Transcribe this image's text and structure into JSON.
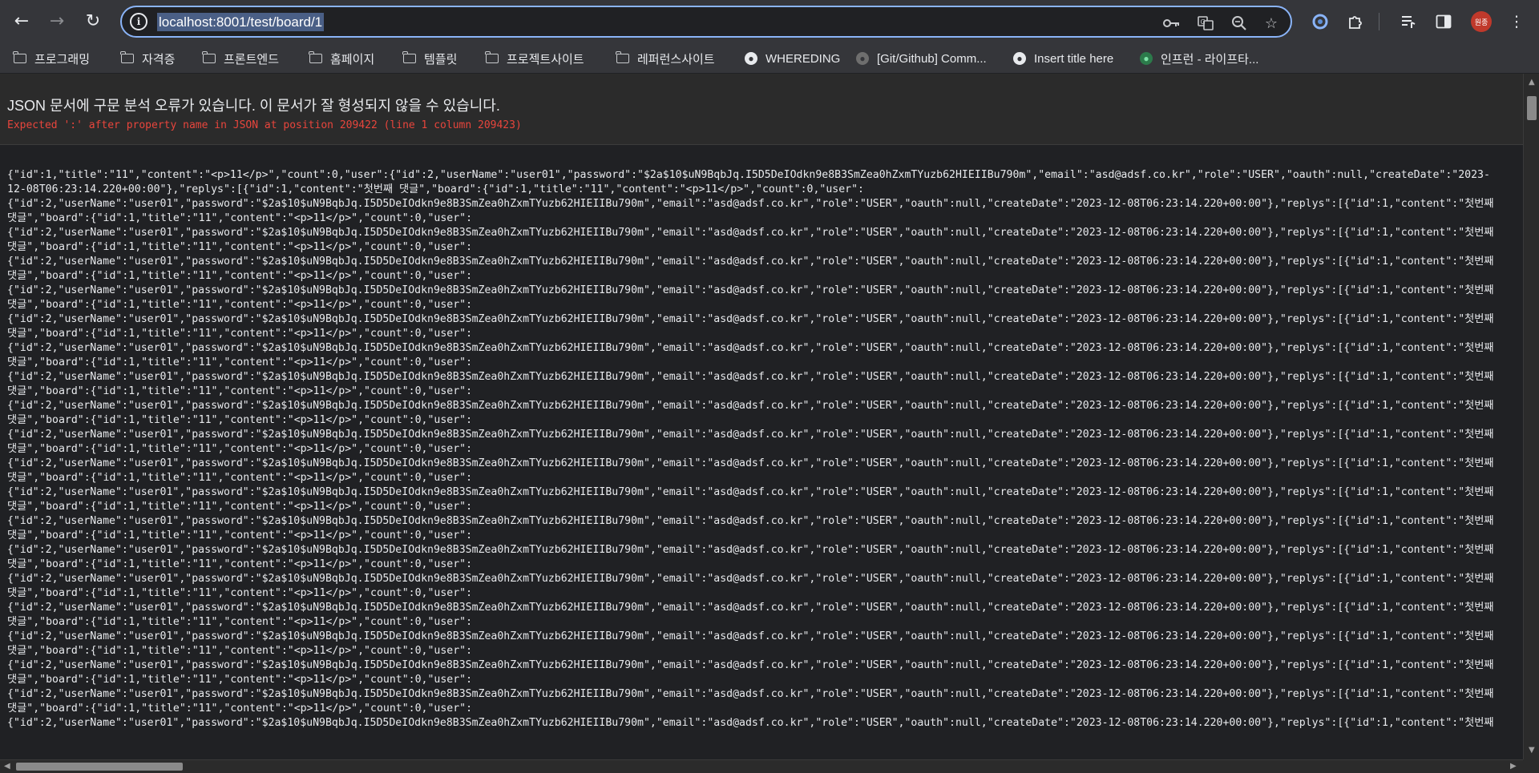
{
  "browser": {
    "url": "localhost:8001/test/board/1",
    "profile_label": "원종",
    "icons": {
      "back": "arrow-left-icon",
      "forward": "arrow-right-icon",
      "reload": "reload-icon",
      "site_info": "info-icon",
      "password": "key-icon",
      "translate": "translate-icon",
      "zoom": "zoom-icon",
      "bookmark": "star-icon",
      "extension_a": "sync-circle-icon",
      "extensions": "puzzle-icon",
      "reading_list": "playlist-icon",
      "side_panel": "side-panel-icon",
      "menu": "more-vertical-icon"
    }
  },
  "bookmarks": [
    {
      "label": "프로그래밍",
      "icon": "folder-icon"
    },
    {
      "label": "자격증",
      "icon": "folder-icon"
    },
    {
      "label": "프론트엔드",
      "icon": "folder-icon"
    },
    {
      "label": "홈페이지",
      "icon": "folder-icon"
    },
    {
      "label": "템플릿",
      "icon": "folder-icon"
    },
    {
      "label": "프로젝트사이트",
      "icon": "folder-icon"
    },
    {
      "label": "레퍼런스사이트",
      "icon": "folder-icon"
    },
    {
      "label": "WHEREDING",
      "icon": "globe-icon"
    },
    {
      "label": "[Git/Github] Comm...",
      "icon": "github-icon"
    },
    {
      "label": "Insert title here",
      "icon": "globe-icon"
    },
    {
      "label": "인프런 - 라이프타...",
      "icon": "inflearn-icon"
    }
  ],
  "error": {
    "title": "JSON 문서에 구문 분석 오류가 있습니다. 이 문서가 잘 형성되지 않을 수 있습니다.",
    "detail": "Expected ':' after property name in JSON at position 209422 (line 1 column 209423)"
  },
  "json_lines": [
    "{\"id\":1,\"title\":\"11\",\"content\":\"<p>11</p>\",\"count\":0,\"user\":{\"id\":2,\"userName\":\"user01\",\"password\":\"$2a$10$uN9BqbJq.I5D5DeIOdkn9e8B3SmZea0hZxmTYuzb62HIEIIBu790m\",\"email\":\"asd@adsf.co.kr\",\"role\":\"USER\",\"oauth\":null,\"createDate\":\"2023-",
    "12-08T06:23:14.220+00:00\"},\"replys\":[{\"id\":1,\"content\":\"첫번째 댓글\",\"board\":{\"id\":1,\"title\":\"11\",\"content\":\"<p>11</p>\",\"count\":0,\"user\":",
    "{\"id\":2,\"userName\":\"user01\",\"password\":\"$2a$10$uN9BqbJq.I5D5DeIOdkn9e8B3SmZea0hZxmTYuzb62HIEIIBu790m\",\"email\":\"asd@adsf.co.kr\",\"role\":\"USER\",\"oauth\":null,\"createDate\":\"2023-12-08T06:23:14.220+00:00\"},\"replys\":[{\"id\":1,\"content\":\"첫번째",
    "댓글\",\"board\":{\"id\":1,\"title\":\"11\",\"content\":\"<p>11</p>\",\"count\":0,\"user\":",
    "{\"id\":2,\"userName\":\"user01\",\"password\":\"$2a$10$uN9BqbJq.I5D5DeIOdkn9e8B3SmZea0hZxmTYuzb62HIEIIBu790m\",\"email\":\"asd@adsf.co.kr\",\"role\":\"USER\",\"oauth\":null,\"createDate\":\"2023-12-08T06:23:14.220+00:00\"},\"replys\":[{\"id\":1,\"content\":\"첫번째",
    "댓글\",\"board\":{\"id\":1,\"title\":\"11\",\"content\":\"<p>11</p>\",\"count\":0,\"user\":",
    "{\"id\":2,\"userName\":\"user01\",\"password\":\"$2a$10$uN9BqbJq.I5D5DeIOdkn9e8B3SmZea0hZxmTYuzb62HIEIIBu790m\",\"email\":\"asd@adsf.co.kr\",\"role\":\"USER\",\"oauth\":null,\"createDate\":\"2023-12-08T06:23:14.220+00:00\"},\"replys\":[{\"id\":1,\"content\":\"첫번째",
    "댓글\",\"board\":{\"id\":1,\"title\":\"11\",\"content\":\"<p>11</p>\",\"count\":0,\"user\":",
    "{\"id\":2,\"userName\":\"user01\",\"password\":\"$2a$10$uN9BqbJq.I5D5DeIOdkn9e8B3SmZea0hZxmTYuzb62HIEIIBu790m\",\"email\":\"asd@adsf.co.kr\",\"role\":\"USER\",\"oauth\":null,\"createDate\":\"2023-12-08T06:23:14.220+00:00\"},\"replys\":[{\"id\":1,\"content\":\"첫번째",
    "댓글\",\"board\":{\"id\":1,\"title\":\"11\",\"content\":\"<p>11</p>\",\"count\":0,\"user\":",
    "{\"id\":2,\"userName\":\"user01\",\"password\":\"$2a$10$uN9BqbJq.I5D5DeIOdkn9e8B3SmZea0hZxmTYuzb62HIEIIBu790m\",\"email\":\"asd@adsf.co.kr\",\"role\":\"USER\",\"oauth\":null,\"createDate\":\"2023-12-08T06:23:14.220+00:00\"},\"replys\":[{\"id\":1,\"content\":\"첫번째",
    "댓글\",\"board\":{\"id\":1,\"title\":\"11\",\"content\":\"<p>11</p>\",\"count\":0,\"user\":",
    "{\"id\":2,\"userName\":\"user01\",\"password\":\"$2a$10$uN9BqbJq.I5D5DeIOdkn9e8B3SmZea0hZxmTYuzb62HIEIIBu790m\",\"email\":\"asd@adsf.co.kr\",\"role\":\"USER\",\"oauth\":null,\"createDate\":\"2023-12-08T06:23:14.220+00:00\"},\"replys\":[{\"id\":1,\"content\":\"첫번째",
    "댓글\",\"board\":{\"id\":1,\"title\":\"11\",\"content\":\"<p>11</p>\",\"count\":0,\"user\":",
    "{\"id\":2,\"userName\":\"user01\",\"password\":\"$2a$10$uN9BqbJq.I5D5DeIOdkn9e8B3SmZea0hZxmTYuzb62HIEIIBu790m\",\"email\":\"asd@adsf.co.kr\",\"role\":\"USER\",\"oauth\":null,\"createDate\":\"2023-12-08T06:23:14.220+00:00\"},\"replys\":[{\"id\":1,\"content\":\"첫번째",
    "댓글\",\"board\":{\"id\":1,\"title\":\"11\",\"content\":\"<p>11</p>\",\"count\":0,\"user\":",
    "{\"id\":2,\"userName\":\"user01\",\"password\":\"$2a$10$uN9BqbJq.I5D5DeIOdkn9e8B3SmZea0hZxmTYuzb62HIEIIBu790m\",\"email\":\"asd@adsf.co.kr\",\"role\":\"USER\",\"oauth\":null,\"createDate\":\"2023-12-08T06:23:14.220+00:00\"},\"replys\":[{\"id\":1,\"content\":\"첫번째",
    "댓글\",\"board\":{\"id\":1,\"title\":\"11\",\"content\":\"<p>11</p>\",\"count\":0,\"user\":",
    "{\"id\":2,\"userName\":\"user01\",\"password\":\"$2a$10$uN9BqbJq.I5D5DeIOdkn9e8B3SmZea0hZxmTYuzb62HIEIIBu790m\",\"email\":\"asd@adsf.co.kr\",\"role\":\"USER\",\"oauth\":null,\"createDate\":\"2023-12-08T06:23:14.220+00:00\"},\"replys\":[{\"id\":1,\"content\":\"첫번째",
    "댓글\",\"board\":{\"id\":1,\"title\":\"11\",\"content\":\"<p>11</p>\",\"count\":0,\"user\":",
    "{\"id\":2,\"userName\":\"user01\",\"password\":\"$2a$10$uN9BqbJq.I5D5DeIOdkn9e8B3SmZea0hZxmTYuzb62HIEIIBu790m\",\"email\":\"asd@adsf.co.kr\",\"role\":\"USER\",\"oauth\":null,\"createDate\":\"2023-12-08T06:23:14.220+00:00\"},\"replys\":[{\"id\":1,\"content\":\"첫번째",
    "댓글\",\"board\":{\"id\":1,\"title\":\"11\",\"content\":\"<p>11</p>\",\"count\":0,\"user\":",
    "{\"id\":2,\"userName\":\"user01\",\"password\":\"$2a$10$uN9BqbJq.I5D5DeIOdkn9e8B3SmZea0hZxmTYuzb62HIEIIBu790m\",\"email\":\"asd@adsf.co.kr\",\"role\":\"USER\",\"oauth\":null,\"createDate\":\"2023-12-08T06:23:14.220+00:00\"},\"replys\":[{\"id\":1,\"content\":\"첫번째",
    "댓글\",\"board\":{\"id\":1,\"title\":\"11\",\"content\":\"<p>11</p>\",\"count\":0,\"user\":",
    "{\"id\":2,\"userName\":\"user01\",\"password\":\"$2a$10$uN9BqbJq.I5D5DeIOdkn9e8B3SmZea0hZxmTYuzb62HIEIIBu790m\",\"email\":\"asd@adsf.co.kr\",\"role\":\"USER\",\"oauth\":null,\"createDate\":\"2023-12-08T06:23:14.220+00:00\"},\"replys\":[{\"id\":1,\"content\":\"첫번째",
    "댓글\",\"board\":{\"id\":1,\"title\":\"11\",\"content\":\"<p>11</p>\",\"count\":0,\"user\":",
    "{\"id\":2,\"userName\":\"user01\",\"password\":\"$2a$10$uN9BqbJq.I5D5DeIOdkn9e8B3SmZea0hZxmTYuzb62HIEIIBu790m\",\"email\":\"asd@adsf.co.kr\",\"role\":\"USER\",\"oauth\":null,\"createDate\":\"2023-12-08T06:23:14.220+00:00\"},\"replys\":[{\"id\":1,\"content\":\"첫번째",
    "댓글\",\"board\":{\"id\":1,\"title\":\"11\",\"content\":\"<p>11</p>\",\"count\":0,\"user\":",
    "{\"id\":2,\"userName\":\"user01\",\"password\":\"$2a$10$uN9BqbJq.I5D5DeIOdkn9e8B3SmZea0hZxmTYuzb62HIEIIBu790m\",\"email\":\"asd@adsf.co.kr\",\"role\":\"USER\",\"oauth\":null,\"createDate\":\"2023-12-08T06:23:14.220+00:00\"},\"replys\":[{\"id\":1,\"content\":\"첫번째",
    "댓글\",\"board\":{\"id\":1,\"title\":\"11\",\"content\":\"<p>11</p>\",\"count\":0,\"user\":",
    "{\"id\":2,\"userName\":\"user01\",\"password\":\"$2a$10$uN9BqbJq.I5D5DeIOdkn9e8B3SmZea0hZxmTYuzb62HIEIIBu790m\",\"email\":\"asd@adsf.co.kr\",\"role\":\"USER\",\"oauth\":null,\"createDate\":\"2023-12-08T06:23:14.220+00:00\"},\"replys\":[{\"id\":1,\"content\":\"첫번째",
    "댓글\",\"board\":{\"id\":1,\"title\":\"11\",\"content\":\"<p>11</p>\",\"count\":0,\"user\":",
    "{\"id\":2,\"userName\":\"user01\",\"password\":\"$2a$10$uN9BqbJq.I5D5DeIOdkn9e8B3SmZea0hZxmTYuzb62HIEIIBu790m\",\"email\":\"asd@adsf.co.kr\",\"role\":\"USER\",\"oauth\":null,\"createDate\":\"2023-12-08T06:23:14.220+00:00\"},\"replys\":[{\"id\":1,\"content\":\"첫번째",
    "댓글\",\"board\":{\"id\":1,\"title\":\"11\",\"content\":\"<p>11</p>\",\"count\":0,\"user\":",
    "{\"id\":2,\"userName\":\"user01\",\"password\":\"$2a$10$uN9BqbJq.I5D5DeIOdkn9e8B3SmZea0hZxmTYuzb62HIEIIBu790m\",\"email\":\"asd@adsf.co.kr\",\"role\":\"USER\",\"oauth\":null,\"createDate\":\"2023-12-08T06:23:14.220+00:00\"},\"replys\":[{\"id\":1,\"content\":\"첫번째",
    "댓글\",\"board\":{\"id\":1,\"title\":\"11\",\"content\":\"<p>11</p>\",\"count\":0,\"user\":",
    "{\"id\":2,\"userName\":\"user01\",\"password\":\"$2a$10$uN9BqbJq.I5D5DeIOdkn9e8B3SmZea0hZxmTYuzb62HIEIIBu790m\",\"email\":\"asd@adsf.co.kr\",\"role\":\"USER\",\"oauth\":null,\"createDate\":\"2023-12-08T06:23:14.220+00:00\"},\"replys\":[{\"id\":1,\"content\":\"첫번째",
    "댓글\",\"board\":{\"id\":1,\"title\":\"11\",\"content\":\"<p>11</p>\",\"count\":0,\"user\":",
    "{\"id\":2,\"userName\":\"user01\",\"password\":\"$2a$10$uN9BqbJq.I5D5DeIOdkn9e8B3SmZea0hZxmTYuzb62HIEIIBu790m\",\"email\":\"asd@adsf.co.kr\",\"role\":\"USER\",\"oauth\":null,\"createDate\":\"2023-12-08T06:23:14.220+00:00\"},\"replys\":[{\"id\":1,\"content\":\"첫번째"
  ]
}
